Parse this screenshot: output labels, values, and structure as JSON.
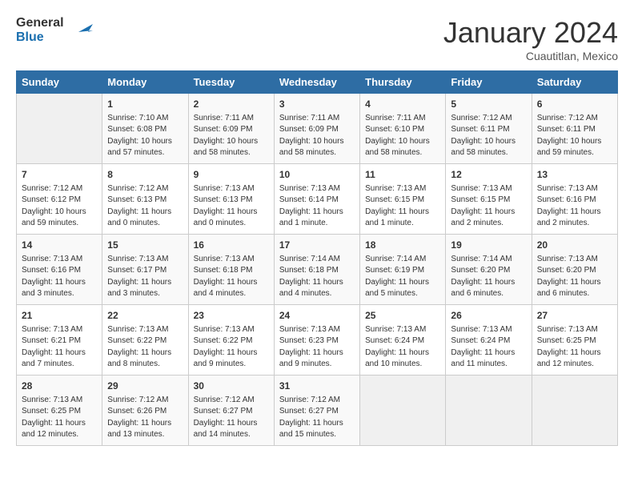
{
  "logo": {
    "line1": "General",
    "line2": "Blue"
  },
  "title": "January 2024",
  "subtitle": "Cuautitlan, Mexico",
  "days_of_week": [
    "Sunday",
    "Monday",
    "Tuesday",
    "Wednesday",
    "Thursday",
    "Friday",
    "Saturday"
  ],
  "weeks": [
    [
      {
        "day": "",
        "sunrise": "",
        "sunset": "",
        "daylight": ""
      },
      {
        "day": "1",
        "sunrise": "Sunrise: 7:10 AM",
        "sunset": "Sunset: 6:08 PM",
        "daylight": "Daylight: 10 hours and 57 minutes."
      },
      {
        "day": "2",
        "sunrise": "Sunrise: 7:11 AM",
        "sunset": "Sunset: 6:09 PM",
        "daylight": "Daylight: 10 hours and 58 minutes."
      },
      {
        "day": "3",
        "sunrise": "Sunrise: 7:11 AM",
        "sunset": "Sunset: 6:09 PM",
        "daylight": "Daylight: 10 hours and 58 minutes."
      },
      {
        "day": "4",
        "sunrise": "Sunrise: 7:11 AM",
        "sunset": "Sunset: 6:10 PM",
        "daylight": "Daylight: 10 hours and 58 minutes."
      },
      {
        "day": "5",
        "sunrise": "Sunrise: 7:12 AM",
        "sunset": "Sunset: 6:11 PM",
        "daylight": "Daylight: 10 hours and 58 minutes."
      },
      {
        "day": "6",
        "sunrise": "Sunrise: 7:12 AM",
        "sunset": "Sunset: 6:11 PM",
        "daylight": "Daylight: 10 hours and 59 minutes."
      }
    ],
    [
      {
        "day": "7",
        "sunrise": "Sunrise: 7:12 AM",
        "sunset": "Sunset: 6:12 PM",
        "daylight": "Daylight: 10 hours and 59 minutes."
      },
      {
        "day": "8",
        "sunrise": "Sunrise: 7:12 AM",
        "sunset": "Sunset: 6:13 PM",
        "daylight": "Daylight: 11 hours and 0 minutes."
      },
      {
        "day": "9",
        "sunrise": "Sunrise: 7:13 AM",
        "sunset": "Sunset: 6:13 PM",
        "daylight": "Daylight: 11 hours and 0 minutes."
      },
      {
        "day": "10",
        "sunrise": "Sunrise: 7:13 AM",
        "sunset": "Sunset: 6:14 PM",
        "daylight": "Daylight: 11 hours and 1 minute."
      },
      {
        "day": "11",
        "sunrise": "Sunrise: 7:13 AM",
        "sunset": "Sunset: 6:15 PM",
        "daylight": "Daylight: 11 hours and 1 minute."
      },
      {
        "day": "12",
        "sunrise": "Sunrise: 7:13 AM",
        "sunset": "Sunset: 6:15 PM",
        "daylight": "Daylight: 11 hours and 2 minutes."
      },
      {
        "day": "13",
        "sunrise": "Sunrise: 7:13 AM",
        "sunset": "Sunset: 6:16 PM",
        "daylight": "Daylight: 11 hours and 2 minutes."
      }
    ],
    [
      {
        "day": "14",
        "sunrise": "Sunrise: 7:13 AM",
        "sunset": "Sunset: 6:16 PM",
        "daylight": "Daylight: 11 hours and 3 minutes."
      },
      {
        "day": "15",
        "sunrise": "Sunrise: 7:13 AM",
        "sunset": "Sunset: 6:17 PM",
        "daylight": "Daylight: 11 hours and 3 minutes."
      },
      {
        "day": "16",
        "sunrise": "Sunrise: 7:13 AM",
        "sunset": "Sunset: 6:18 PM",
        "daylight": "Daylight: 11 hours and 4 minutes."
      },
      {
        "day": "17",
        "sunrise": "Sunrise: 7:14 AM",
        "sunset": "Sunset: 6:18 PM",
        "daylight": "Daylight: 11 hours and 4 minutes."
      },
      {
        "day": "18",
        "sunrise": "Sunrise: 7:14 AM",
        "sunset": "Sunset: 6:19 PM",
        "daylight": "Daylight: 11 hours and 5 minutes."
      },
      {
        "day": "19",
        "sunrise": "Sunrise: 7:14 AM",
        "sunset": "Sunset: 6:20 PM",
        "daylight": "Daylight: 11 hours and 6 minutes."
      },
      {
        "day": "20",
        "sunrise": "Sunrise: 7:13 AM",
        "sunset": "Sunset: 6:20 PM",
        "daylight": "Daylight: 11 hours and 6 minutes."
      }
    ],
    [
      {
        "day": "21",
        "sunrise": "Sunrise: 7:13 AM",
        "sunset": "Sunset: 6:21 PM",
        "daylight": "Daylight: 11 hours and 7 minutes."
      },
      {
        "day": "22",
        "sunrise": "Sunrise: 7:13 AM",
        "sunset": "Sunset: 6:22 PM",
        "daylight": "Daylight: 11 hours and 8 minutes."
      },
      {
        "day": "23",
        "sunrise": "Sunrise: 7:13 AM",
        "sunset": "Sunset: 6:22 PM",
        "daylight": "Daylight: 11 hours and 9 minutes."
      },
      {
        "day": "24",
        "sunrise": "Sunrise: 7:13 AM",
        "sunset": "Sunset: 6:23 PM",
        "daylight": "Daylight: 11 hours and 9 minutes."
      },
      {
        "day": "25",
        "sunrise": "Sunrise: 7:13 AM",
        "sunset": "Sunset: 6:24 PM",
        "daylight": "Daylight: 11 hours and 10 minutes."
      },
      {
        "day": "26",
        "sunrise": "Sunrise: 7:13 AM",
        "sunset": "Sunset: 6:24 PM",
        "daylight": "Daylight: 11 hours and 11 minutes."
      },
      {
        "day": "27",
        "sunrise": "Sunrise: 7:13 AM",
        "sunset": "Sunset: 6:25 PM",
        "daylight": "Daylight: 11 hours and 12 minutes."
      }
    ],
    [
      {
        "day": "28",
        "sunrise": "Sunrise: 7:13 AM",
        "sunset": "Sunset: 6:25 PM",
        "daylight": "Daylight: 11 hours and 12 minutes."
      },
      {
        "day": "29",
        "sunrise": "Sunrise: 7:12 AM",
        "sunset": "Sunset: 6:26 PM",
        "daylight": "Daylight: 11 hours and 13 minutes."
      },
      {
        "day": "30",
        "sunrise": "Sunrise: 7:12 AM",
        "sunset": "Sunset: 6:27 PM",
        "daylight": "Daylight: 11 hours and 14 minutes."
      },
      {
        "day": "31",
        "sunrise": "Sunrise: 7:12 AM",
        "sunset": "Sunset: 6:27 PM",
        "daylight": "Daylight: 11 hours and 15 minutes."
      },
      {
        "day": "",
        "sunrise": "",
        "sunset": "",
        "daylight": ""
      },
      {
        "day": "",
        "sunrise": "",
        "sunset": "",
        "daylight": ""
      },
      {
        "day": "",
        "sunrise": "",
        "sunset": "",
        "daylight": ""
      }
    ]
  ]
}
